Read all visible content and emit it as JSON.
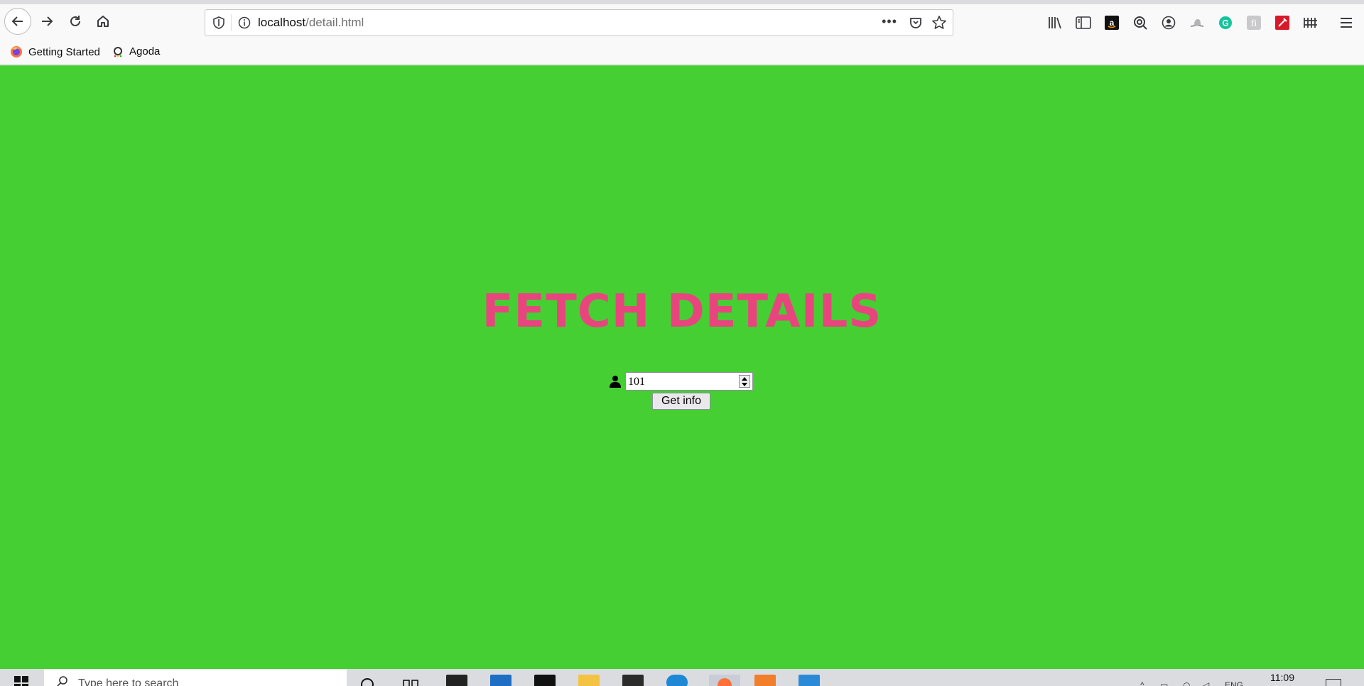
{
  "browser": {
    "url_host": "localhost",
    "url_path": "/detail.html",
    "more_label": "•••"
  },
  "bookmarks": [
    {
      "label": "Getting Started",
      "icon": "firefox-icon"
    },
    {
      "label": "Agoda",
      "icon": "agoda-icon"
    }
  ],
  "page": {
    "background": "#45cf33",
    "title_color": "#e8457f",
    "title": "FETCH DETAILS",
    "id_input_value": "101",
    "get_info_label": "Get info"
  },
  "taskbar": {
    "search_placeholder": "Type here to search",
    "tray_lang": "ENG",
    "clock": "11:09"
  }
}
